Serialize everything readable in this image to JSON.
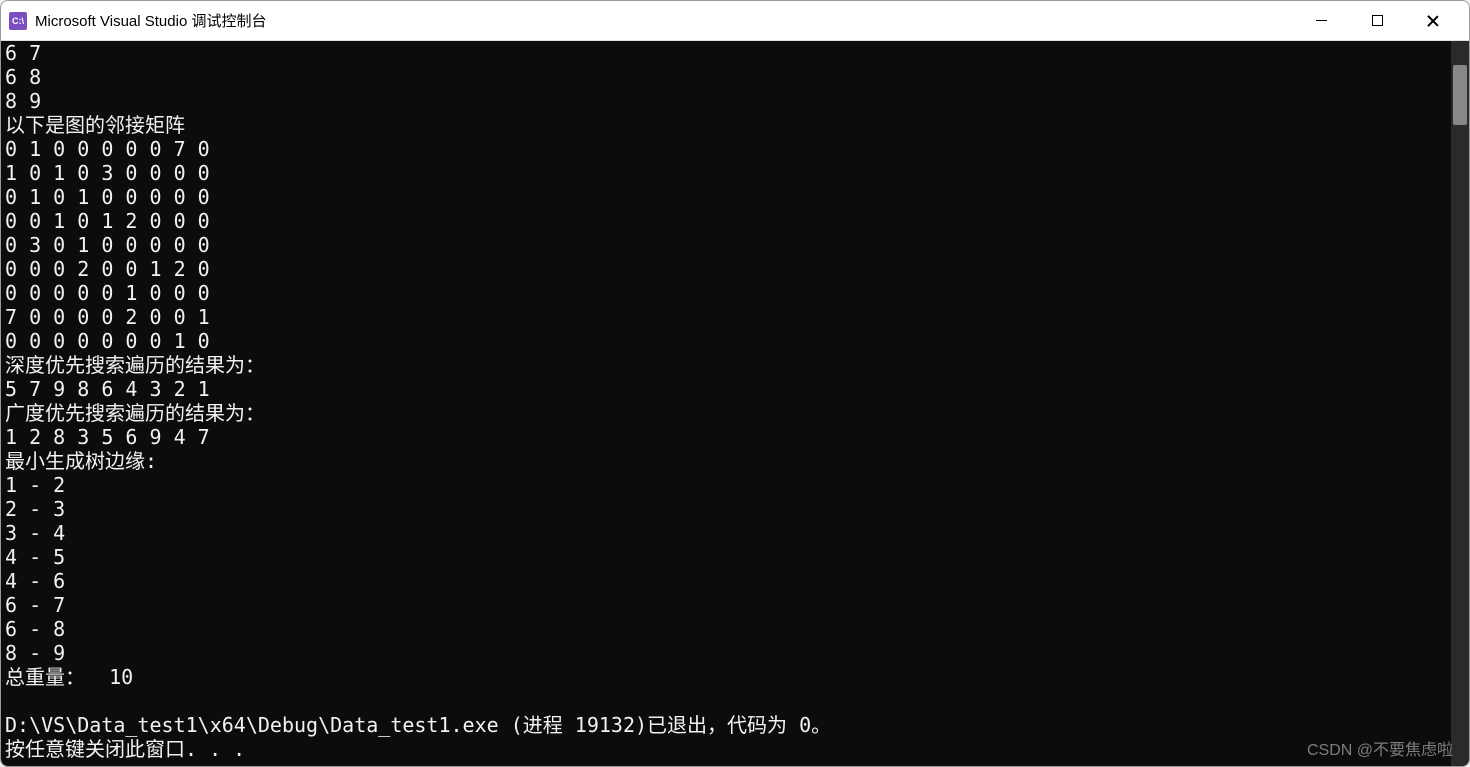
{
  "window": {
    "icon_text": "C:\\",
    "title": "Microsoft Visual Studio 调试控制台"
  },
  "console": {
    "lines": [
      "6 7",
      "6 8",
      "8 9",
      "以下是图的邻接矩阵",
      "0 1 0 0 0 0 0 7 0",
      "1 0 1 0 3 0 0 0 0",
      "0 1 0 1 0 0 0 0 0",
      "0 0 1 0 1 2 0 0 0",
      "0 3 0 1 0 0 0 0 0",
      "0 0 0 2 0 0 1 2 0",
      "0 0 0 0 0 1 0 0 0",
      "7 0 0 0 0 2 0 0 1",
      "0 0 0 0 0 0 0 1 0",
      "深度优先搜索遍历的结果为：",
      "5 7 9 8 6 4 3 2 1",
      "广度优先搜索遍历的结果为：",
      "1 2 8 3 5 6 9 4 7",
      "最小生成树边缘:",
      "1 - 2",
      "2 - 3",
      "3 - 4",
      "4 - 5",
      "4 - 6",
      "6 - 7",
      "6 - 8",
      "8 - 9",
      "总重量：  10",
      "",
      "D:\\VS\\Data_test1\\x64\\Debug\\Data_test1.exe (进程 19132)已退出，代码为 0。",
      "按任意键关闭此窗口. . ."
    ]
  },
  "watermark": "CSDN @不要焦虑啦"
}
